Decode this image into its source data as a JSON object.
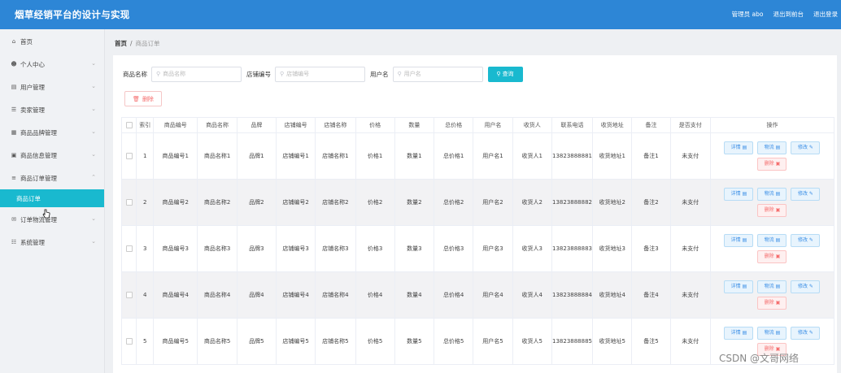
{
  "app": {
    "title": "烟草经销平台的设计与实现"
  },
  "topbar": {
    "user": "管理员 abo",
    "to_front": "退出到前台",
    "logout": "退出登录"
  },
  "sidebar": {
    "items": [
      {
        "label": "首页",
        "icon": "home-icon"
      },
      {
        "label": "个人中心",
        "icon": "user-icon"
      },
      {
        "label": "用户管理",
        "icon": "users-icon"
      },
      {
        "label": "卖家管理",
        "icon": "seller-icon"
      },
      {
        "label": "商品品牌管理",
        "icon": "brand-icon"
      },
      {
        "label": "商品信息管理",
        "icon": "goods-icon"
      },
      {
        "label": "商品订单管理",
        "icon": "order-icon"
      }
    ],
    "active_sub": "商品订单",
    "items_after": [
      {
        "label": "订单物流管理",
        "icon": "logistics-icon"
      },
      {
        "label": "系统管理",
        "icon": "system-icon"
      }
    ]
  },
  "breadcrumb": {
    "home": "首页",
    "sep": "/",
    "current": "商品订单"
  },
  "search": {
    "f1_label": "商品名称",
    "f1_placeholder": "商品名称",
    "f2_label": "店铺编号",
    "f2_placeholder": "店铺编号",
    "f3_label": "用户名",
    "f3_placeholder": "用户名",
    "button": "查询"
  },
  "toolbar": {
    "delete": "删除"
  },
  "table": {
    "headers": [
      "",
      "索引",
      "商品编号",
      "商品名称",
      "品牌",
      "店铺编号",
      "店铺名称",
      "价格",
      "数量",
      "总价格",
      "用户名",
      "收货人",
      "联系电话",
      "收货地址",
      "备注",
      "是否支付",
      "操作"
    ],
    "rows": [
      [
        "1",
        "商品编号1",
        "商品名称1",
        "品牌1",
        "店铺编号1",
        "店铺名称1",
        "价格1",
        "数量1",
        "总价格1",
        "用户名1",
        "收货人1",
        "13823888881",
        "收货地址1",
        "备注1",
        "未支付"
      ],
      [
        "2",
        "商品编号2",
        "商品名称2",
        "品牌2",
        "店铺编号2",
        "店铺名称2",
        "价格2",
        "数量2",
        "总价格2",
        "用户名2",
        "收货人2",
        "13823888882",
        "收货地址2",
        "备注2",
        "未支付"
      ],
      [
        "3",
        "商品编号3",
        "商品名称3",
        "品牌3",
        "店铺编号3",
        "店铺名称3",
        "价格3",
        "数量3",
        "总价格3",
        "用户名3",
        "收货人3",
        "13823888883",
        "收货地址3",
        "备注3",
        "未支付"
      ],
      [
        "4",
        "商品编号4",
        "商品名称4",
        "品牌4",
        "店铺编号4",
        "店铺名称4",
        "价格4",
        "数量4",
        "总价格4",
        "用户名4",
        "收货人4",
        "13823888884",
        "收货地址4",
        "备注4",
        "未支付"
      ],
      [
        "5",
        "商品编号5",
        "商品名称5",
        "品牌5",
        "店铺编号5",
        "店铺名称5",
        "价格5",
        "数量5",
        "总价格5",
        "用户名5",
        "收货人5",
        "13823888885",
        "收货地址5",
        "备注5",
        "未支付"
      ]
    ],
    "actions": {
      "detail": "详情",
      "logistics": "物流",
      "edit": "修改",
      "delete": "删除"
    }
  },
  "watermark": "CSDN @文哥网络"
}
